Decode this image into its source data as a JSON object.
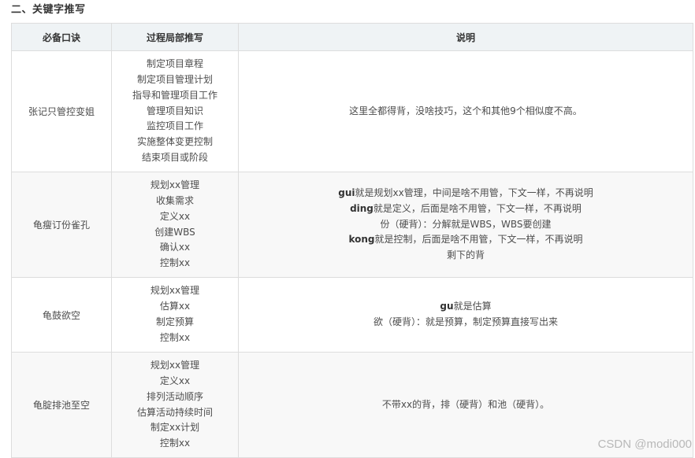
{
  "heading": "二、关键字推写",
  "table": {
    "headers": [
      "必备口诀",
      "过程局部推写",
      "说明"
    ],
    "rows": [
      {
        "mnemonic": "张记只管控变姐",
        "processes": [
          "制定项目章程",
          "制定项目管理计划",
          "指导和管理项目工作",
          "管理项目知识",
          "监控项目工作",
          "实施整体变更控制",
          "结束项目或阶段"
        ],
        "explanation": [
          {
            "key": "",
            "text": "这里全都得背，没啥技巧，这个和其他9个相似度不高。"
          }
        ]
      },
      {
        "mnemonic": "龟瘦订份雀孔",
        "processes": [
          "规划xx管理",
          "收集需求",
          "定义xx",
          "创建WBS",
          "确认xx",
          "控制xx"
        ],
        "explanation": [
          {
            "key": "gui",
            "text": "就是规划xx管理，中间是啥不用管，下文一样，不再说明"
          },
          {
            "key": "ding",
            "text": "就是定义，后面是啥不用管，下文一样，不再说明"
          },
          {
            "key": "",
            "text": "份（硬背）：分解就是WBS，WBS要创建"
          },
          {
            "key": "kong",
            "text": "就是控制，后面是啥不用管，下文一样，不再说明"
          },
          {
            "key": "",
            "text": "剩下的背"
          }
        ]
      },
      {
        "mnemonic": "龟鼓欲空",
        "processes": [
          "规划xx管理",
          "估算xx",
          "制定预算",
          "控制xx"
        ],
        "explanation": [
          {
            "key": "gu",
            "text": "就是估算"
          },
          {
            "key": "",
            "text": "欲（硬背）：就是预算，制定预算直接写出来"
          }
        ]
      },
      {
        "mnemonic": "龟腚排池至空",
        "processes": [
          "规划xx管理",
          "定义xx",
          "排列活动顺序",
          "估算活动持续时间",
          "制定xx计划",
          "控制xx"
        ],
        "explanation": [
          {
            "key": "",
            "text": "不带xx的背，排（硬背）和池（硬背）。"
          }
        ]
      }
    ]
  },
  "watermark": "CSDN @modi000"
}
